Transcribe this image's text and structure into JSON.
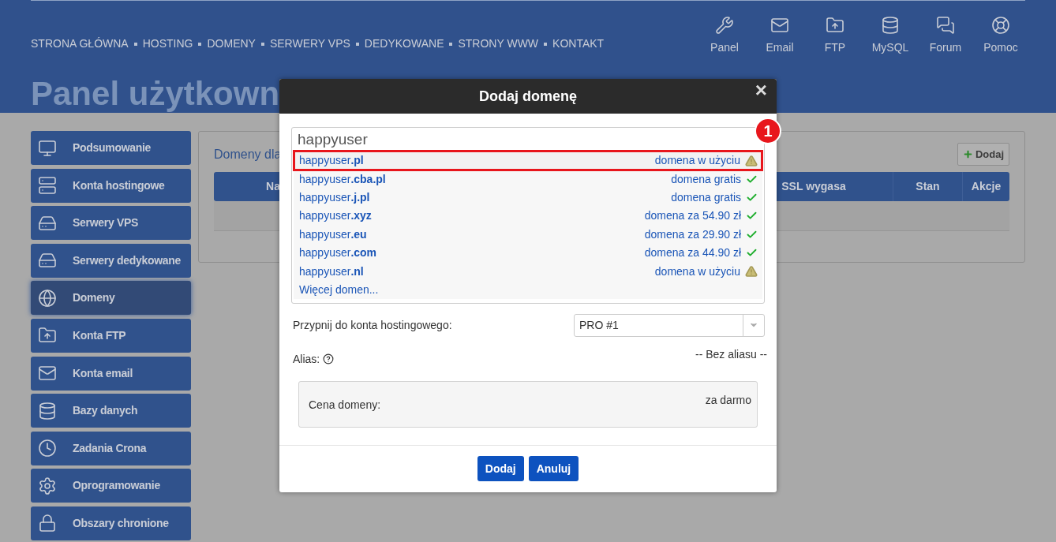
{
  "header": {
    "nav": [
      "STRONA GŁÓWNA",
      "HOSTING",
      "DOMENY",
      "SERWERY VPS",
      "DEDYKOWANE",
      "STRONY WWW",
      "KONTAKT"
    ],
    "shortcuts": [
      "Panel",
      "Email",
      "FTP",
      "MySQL",
      "Forum",
      "Pomoc"
    ]
  },
  "page_title": "Panel użytkown",
  "sidebar": {
    "items": [
      {
        "label": "Podsumowanie",
        "selected": false
      },
      {
        "label": "Konta hostingowe",
        "selected": false
      },
      {
        "label": "Serwery VPS",
        "selected": false
      },
      {
        "label": "Serwery dedykowane",
        "selected": false
      },
      {
        "label": "Domeny",
        "selected": true
      },
      {
        "label": "Konta FTP",
        "selected": false
      },
      {
        "label": "Konta email",
        "selected": false
      },
      {
        "label": "Bazy danych",
        "selected": false
      },
      {
        "label": "Zadania Crona",
        "selected": false
      },
      {
        "label": "Oprogramowanie",
        "selected": false
      },
      {
        "label": "Obszary chronione",
        "selected": false
      }
    ]
  },
  "content": {
    "heading": "Domeny dla",
    "add_button": "Dodaj",
    "table": {
      "columns": [
        "Na",
        "SSL wygasa",
        "Stan",
        "Akcje"
      ]
    }
  },
  "dialog": {
    "title": "Dodaj domenę",
    "close": "×",
    "search": {
      "value": "happyuser"
    },
    "suggestions": [
      {
        "domain": "happyuser**.pl**",
        "status": "domena w użyciu",
        "available": false,
        "highlighted": true
      },
      {
        "domain": "happyuser**.cba.pl**",
        "status": "domena gratis",
        "available": true,
        "highlighted": false
      },
      {
        "domain": "happyuser**.j.pl**",
        "status": "domena gratis",
        "available": true,
        "highlighted": false
      },
      {
        "domain": "happyuser**.xyz**",
        "status": "domena za 54.90 zł",
        "available": true,
        "highlighted": false
      },
      {
        "domain": "happyuser**.eu**",
        "status": "domena za 29.90 zł",
        "available": true,
        "highlighted": false
      },
      {
        "domain": "happyuser**.com**",
        "status": "domena za 44.90 zł",
        "available": true,
        "highlighted": false
      },
      {
        "domain": "happyuser**.nl**",
        "status": "domena w użyciu",
        "available": false,
        "highlighted": false
      }
    ],
    "more_link": "Więcej domen...",
    "callout": "1",
    "hosting": {
      "label": "Przypnij do konta hostingowego:",
      "value": "PRO #1"
    },
    "alias": {
      "label": "Alias:",
      "value": "-- Bez aliasu --"
    },
    "price": {
      "label": "Cena domeny:",
      "value": "za darmo"
    },
    "buttons": [
      "Dodaj",
      "Anuluj"
    ]
  }
}
